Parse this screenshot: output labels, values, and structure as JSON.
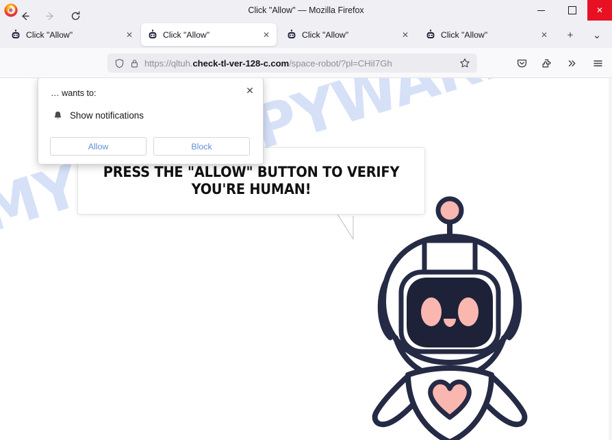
{
  "window": {
    "title": "Click \"Allow\" — Mozilla Firefox",
    "logo_icon": "firefox-logo",
    "minimize_label": "—",
    "maximize_label": "□",
    "close_label": "✕",
    "close_color": "#e81123"
  },
  "tabs": {
    "items": [
      {
        "label": "Click \"Allow\"",
        "favicon": "robot-favicon",
        "active": false,
        "close_label": "✕"
      },
      {
        "label": "Click \"Allow\"",
        "favicon": "robot-favicon",
        "active": true,
        "close_label": "✕"
      },
      {
        "label": "Click \"Allow\"",
        "favicon": "robot-favicon",
        "active": false,
        "close_label": "✕"
      },
      {
        "label": "Click \"Allow\"",
        "favicon": "robot-favicon",
        "active": false,
        "close_label": "✕"
      }
    ],
    "new_tab_label": "+",
    "list_all_label": "⌄"
  },
  "toolbar": {
    "back_icon": "back-arrow-icon",
    "forward_icon": "forward-arrow-icon",
    "reload_icon": "reload-icon",
    "shield_icon": "shield-icon",
    "lock_icon": "padlock-icon",
    "star_icon": "bookmark-star-icon",
    "pocket_icon": "pocket-icon",
    "extensions_icon": "extensions-puzzle-icon",
    "overflow_icon": "double-chevron-icon",
    "menu_icon": "hamburger-menu-icon"
  },
  "url": {
    "scheme": "https://",
    "subdomain": "qltuh.",
    "domain": "check-tl-ver-128-c.com",
    "path": "/space-robot/?pl=CHiI7Gh"
  },
  "permission_dialog": {
    "origin_label": "… wants to:",
    "permission_icon": "bell-icon",
    "permission_label": "Show notifications",
    "allow_label": "Allow",
    "block_label": "Block",
    "close_label": "✕",
    "link_color": "#5a8fd8"
  },
  "page": {
    "headline_line1": "PRESS THE \"ALLOW\" BUTTON TO VERIFY",
    "headline_line2": "YOU'RE HUMAN!",
    "watermark": "MYANTISPYWARE.COM",
    "watermark_color": "#cfdcf7",
    "robot_icon": "space-robot-mascot",
    "robot_outline_color": "#252a45",
    "robot_accent_color": "#f9b7b0",
    "robot_visor_color": "#1d2238"
  }
}
